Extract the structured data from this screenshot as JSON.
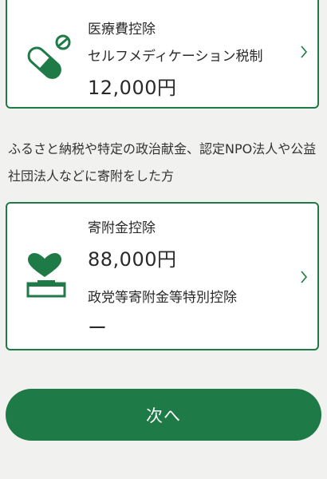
{
  "medical_card": {
    "title": "医療費控除",
    "subtitle": "セルフメディケーション税制",
    "amount": "12,000円",
    "icon": "pill-icon"
  },
  "description": "ふるさと納税や特定の政治献金、認定NPO法人や公益社団法人などに寄附をした方",
  "donation_card": {
    "title": "寄附金控除",
    "amount": "88,000円",
    "subtitle": "政党等寄附金等特別控除",
    "sub_amount": "ー",
    "icon": "donation-box-icon"
  },
  "next_button": {
    "label": "次へ"
  },
  "colors": {
    "accent": "#1e7a46",
    "background": "#f1f1ef"
  }
}
